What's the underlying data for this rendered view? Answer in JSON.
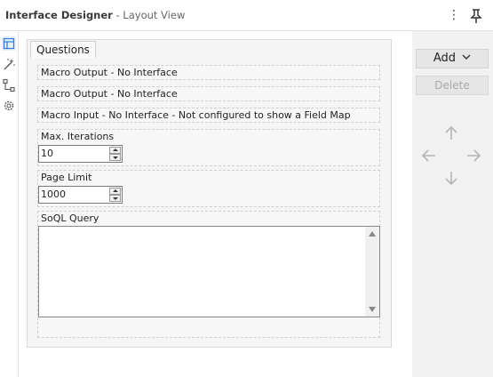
{
  "header": {
    "title": "Interface Designer",
    "subtitle": "- Layout View",
    "menu_icon": "vertical-ellipsis-icon",
    "pin_icon": "pin-icon"
  },
  "left_rail": {
    "items": [
      {
        "icon": "layout-view-icon"
      },
      {
        "icon": "magic-wand-icon"
      },
      {
        "icon": "tree-view-icon"
      },
      {
        "icon": "properties-gear-icon"
      }
    ]
  },
  "canvas": {
    "tab": "Questions",
    "questions": [
      {
        "label": "Macro Output - No Interface"
      },
      {
        "label": "Macro Output - No Interface"
      },
      {
        "label": "Macro Input - No Interface - Not configured to show a Field Map"
      },
      {
        "label": "Max. Iterations",
        "value": "10"
      },
      {
        "label": "Page Limit",
        "value": "1000"
      },
      {
        "label": "SoQL Query",
        "value": ""
      }
    ]
  },
  "right_panel": {
    "add_label": "Add",
    "delete_label": "Delete",
    "move_icons": [
      "arrow-up-icon",
      "arrow-left-icon",
      "arrow-right-icon",
      "arrow-down-icon"
    ]
  },
  "colors": {
    "accent": "#2f7bd6",
    "panel_bg": "#f5f5f5",
    "sidebar_bg": "#f2f2f2"
  }
}
